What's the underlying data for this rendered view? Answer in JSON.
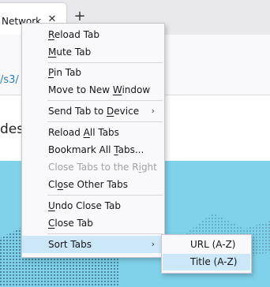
{
  "browser": {
    "tab_title": "Network",
    "tab_close_glyph": "✕",
    "new_tab_glyph": "+",
    "url_fragment": "/s3/",
    "content_text": "des"
  },
  "context_menu": {
    "items": [
      {
        "pre": "",
        "u": "R",
        "post": "eload Tab",
        "enabled": true
      },
      {
        "pre": "",
        "u": "M",
        "post": "ute Tab",
        "enabled": true
      },
      {
        "pre": "",
        "u": "P",
        "post": "in Tab",
        "enabled": true
      },
      {
        "pre": "Move to New ",
        "u": "W",
        "post": "indow",
        "enabled": true
      },
      {
        "pre": "Send Tab to ",
        "u": "D",
        "post": "evice",
        "enabled": true,
        "submenu_arrow": "›"
      },
      {
        "pre": "Reload ",
        "u": "A",
        "post": "ll Tabs",
        "enabled": true
      },
      {
        "pre": "Bookmark All ",
        "u": "T",
        "post": "abs...",
        "enabled": true
      },
      {
        "pre": "Close Tabs to the R",
        "u": "i",
        "post": "ght",
        "enabled": false
      },
      {
        "pre": "Cl",
        "u": "o",
        "post": "se Other Tabs",
        "enabled": true
      },
      {
        "pre": "",
        "u": "U",
        "post": "ndo Close Tab",
        "enabled": true
      },
      {
        "pre": "",
        "u": "C",
        "post": "lose Tab",
        "enabled": true
      },
      {
        "pre": "Sort Tabs",
        "u": "",
        "post": "",
        "enabled": true,
        "submenu_arrow": "›",
        "highlighted": true
      }
    ]
  },
  "sort_submenu": {
    "items": [
      {
        "label": "URL (A-Z)",
        "highlighted": false
      },
      {
        "label": "Title (A-Z)",
        "highlighted": true
      }
    ]
  },
  "colors": {
    "highlight": "#cce7f7",
    "disabled_text": "#a0a0a5",
    "hero_background": "#7fd2ea",
    "url_text": "#2a7fb2"
  }
}
